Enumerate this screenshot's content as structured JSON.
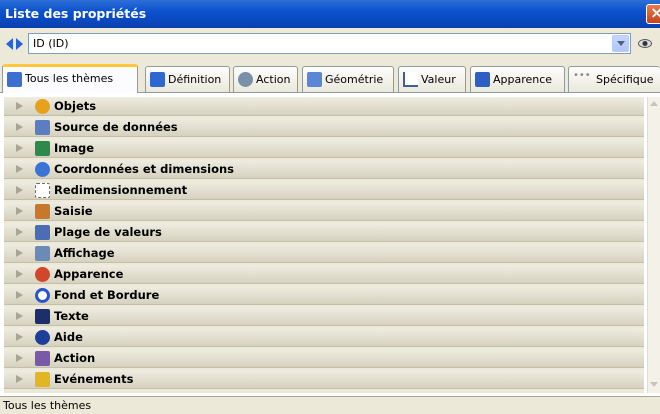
{
  "window": {
    "title": "Liste des propriétés"
  },
  "object_selector": {
    "value": "ID (ID)"
  },
  "tabs": [
    {
      "label": "Tous les thèmes",
      "icon": "list-icon",
      "color": "#3b6fd1"
    },
    {
      "label": "Définition",
      "icon": "definition-icon",
      "color": "#2f66cf"
    },
    {
      "label": "Action",
      "icon": "gear-icon",
      "color": "#7a8fa8"
    },
    {
      "label": "Géométrie",
      "icon": "geometry-icon",
      "color": "#5a86d6"
    },
    {
      "label": "Valeur",
      "icon": "graph-icon",
      "color": "#3d5fa0"
    },
    {
      "label": "Apparence",
      "icon": "monitor-icon",
      "color": "#2e5fc4"
    },
    {
      "label": "Spécifique",
      "icon": "dots-icon",
      "color": "#8a8a8a"
    }
  ],
  "categories": [
    {
      "label": "Objets",
      "icon": "cube-icon",
      "color": "#e7a21d"
    },
    {
      "label": "Source de données",
      "icon": "database-icon",
      "color": "#5b7ec2"
    },
    {
      "label": "Image",
      "icon": "image-icon",
      "color": "#2c8a4a"
    },
    {
      "label": "Coordonnées et dimensions",
      "icon": "move-icon",
      "color": "#3b74d6"
    },
    {
      "label": "Redimensionnement",
      "icon": "resize-icon",
      "color": "#6d6d6d"
    },
    {
      "label": "Saisie",
      "icon": "input-icon",
      "color": "#c8782a"
    },
    {
      "label": "Plage de valeurs",
      "icon": "range-icon",
      "color": "#4c6db3"
    },
    {
      "label": "Affichage",
      "icon": "display-icon",
      "color": "#6a8bb8"
    },
    {
      "label": "Apparence",
      "icon": "palette-icon",
      "color": "#d2462a"
    },
    {
      "label": "Fond et Bordure",
      "icon": "border-icon",
      "color": "#2756c9"
    },
    {
      "label": "Texte",
      "icon": "text-icon",
      "color": "#1c2f6b"
    },
    {
      "label": "Aide",
      "icon": "help-icon",
      "color": "#1d3f9c"
    },
    {
      "label": "Action",
      "icon": "action-icon",
      "color": "#7a5aa8"
    },
    {
      "label": "Evénements",
      "icon": "events-icon",
      "color": "#e2b522"
    }
  ],
  "status": {
    "text": "Tous les thèmes"
  }
}
